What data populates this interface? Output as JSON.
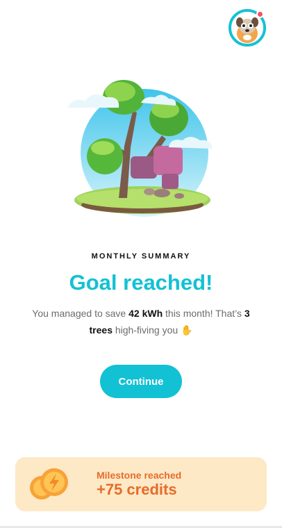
{
  "profile": {
    "avatar_icon": "dog-avatar-icon",
    "notification_color": "#ff4d5e"
  },
  "summary": {
    "kicker": "MONTHLY SUMMARY",
    "title": "Goal reached!",
    "desc_part1": "You managed to save ",
    "energy": "42 kWh",
    "desc_part2": " this month! That’s ",
    "trees": "3 trees",
    "desc_part3": " high-fiving you ",
    "emoji": "✋"
  },
  "actions": {
    "continue_label": "Continue"
  },
  "milestone": {
    "label": "Milestone reached",
    "value": "+75 credits",
    "icon": "coin-lightning-icon"
  },
  "colors": {
    "accent": "#12c1d3",
    "milestone_bg": "#fde9c6",
    "milestone_text": "#e86a2a"
  }
}
